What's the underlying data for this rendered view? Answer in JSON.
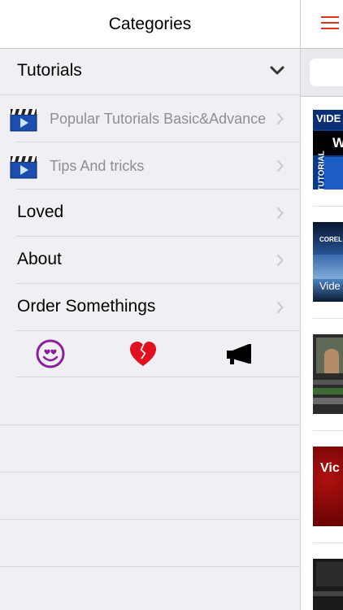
{
  "drawer": {
    "title": "Categories",
    "sections": [
      {
        "label": "Tutorials",
        "expanded": true
      }
    ],
    "sub_items": [
      {
        "label": "Popular Tutorials Basic&Advance",
        "icon": "clapperboard-icon"
      },
      {
        "label": "Tips And tricks",
        "icon": "clapperboard-icon"
      }
    ],
    "items": [
      {
        "label": "Loved"
      },
      {
        "label": "About"
      },
      {
        "label": "Order Somethings"
      }
    ],
    "emoji_icons": [
      "heart-eyes-face-icon",
      "broken-heart-icon",
      "megaphone-icon"
    ]
  },
  "content": {
    "menu_icon": "hamburger-menu-icon",
    "thumbnails": [
      {
        "text_1": "VIDE",
        "text_2": "W",
        "text_3": "TUTORIAL"
      },
      {
        "text_1": "COREL",
        "text_2": "Vide"
      },
      {
        "text_1": ""
      },
      {
        "text_1": "Vic"
      },
      {
        "text_1": ""
      }
    ]
  },
  "colors": {
    "accent": "#e0301e",
    "drawer_bg": "#efeff4",
    "secondary_text": "#8e8e93"
  }
}
